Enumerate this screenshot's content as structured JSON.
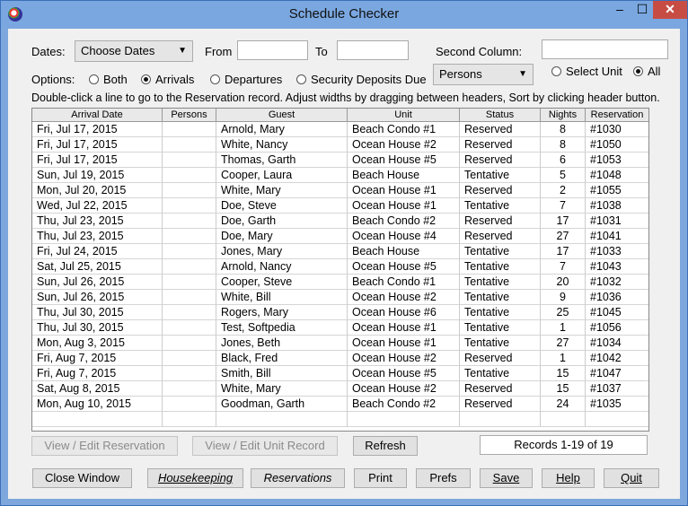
{
  "window": {
    "title": "Schedule Checker",
    "min_glyph": "–",
    "max_glyph": "☐",
    "close_glyph": "✕"
  },
  "filters": {
    "dates_label": "Dates:",
    "dates_value": "Choose Dates",
    "from_label": "From",
    "from_value": "",
    "to_label": "To",
    "to_value": "",
    "second_column_label": "Second Column:",
    "second_column_value": ""
  },
  "options": {
    "label": "Options:",
    "radios": [
      {
        "label": "Both",
        "selected": false
      },
      {
        "label": "Arrivals",
        "selected": true
      },
      {
        "label": "Departures",
        "selected": false
      },
      {
        "label": "Security Deposits Due",
        "selected": false
      }
    ],
    "column_select": "Persons",
    "unit_radios": [
      {
        "label": "Select Unit",
        "selected": false
      },
      {
        "label": "All",
        "selected": true
      }
    ]
  },
  "hint": "Double-click a line to go to the Reservation record. Adjust widths by dragging between headers, Sort by clicking header button.",
  "table": {
    "headers": [
      "Arrival Date",
      "Persons",
      "Guest",
      "Unit",
      "Status",
      "Nights",
      "Reservation"
    ],
    "rows": [
      [
        "Fri, Jul 17, 2015",
        "",
        "Arnold, Mary",
        "Beach Condo #1",
        "Reserved",
        "8",
        "#1030"
      ],
      [
        "Fri, Jul 17, 2015",
        "",
        "White, Nancy",
        "Ocean House #2",
        "Reserved",
        "8",
        "#1050"
      ],
      [
        "Fri, Jul 17, 2015",
        "",
        "Thomas, Garth",
        "Ocean House #5",
        "Reserved",
        "6",
        "#1053"
      ],
      [
        "Sun, Jul 19, 2015",
        "",
        "Cooper, Laura",
        "Beach House",
        "Tentative",
        "5",
        "#1048"
      ],
      [
        "Mon, Jul 20, 2015",
        "",
        "White, Mary",
        "Ocean House #1",
        "Reserved",
        "2",
        "#1055"
      ],
      [
        "Wed, Jul 22, 2015",
        "",
        "Doe, Steve",
        "Ocean House #1",
        "Tentative",
        "7",
        "#1038"
      ],
      [
        "Thu, Jul 23, 2015",
        "",
        "Doe, Garth",
        "Beach Condo #2",
        "Reserved",
        "17",
        "#1031"
      ],
      [
        "Thu, Jul 23, 2015",
        "",
        "Doe, Mary",
        "Ocean House #4",
        "Reserved",
        "27",
        "#1041"
      ],
      [
        "Fri, Jul 24, 2015",
        "",
        "Jones, Mary",
        "Beach House",
        "Tentative",
        "17",
        "#1033"
      ],
      [
        "Sat, Jul 25, 2015",
        "",
        "Arnold, Nancy",
        "Ocean House #5",
        "Tentative",
        "7",
        "#1043"
      ],
      [
        "Sun, Jul 26, 2015",
        "",
        "Cooper, Steve",
        "Beach Condo #1",
        "Tentative",
        "20",
        "#1032"
      ],
      [
        "Sun, Jul 26, 2015",
        "",
        "White, Bill",
        "Ocean House #2",
        "Tentative",
        "9",
        "#1036"
      ],
      [
        "Thu, Jul 30, 2015",
        "",
        "Rogers, Mary",
        "Ocean House #6",
        "Tentative",
        "25",
        "#1045"
      ],
      [
        "Thu, Jul 30, 2015",
        "",
        "Test, Softpedia",
        "Ocean House #1",
        "Tentative",
        "1",
        "#1056"
      ],
      [
        "Mon, Aug 3, 2015",
        "",
        "Jones, Beth",
        "Ocean House #1",
        "Tentative",
        "27",
        "#1034"
      ],
      [
        "Fri, Aug 7, 2015",
        "",
        "Black, Fred",
        "Ocean House #2",
        "Reserved",
        "1",
        "#1042"
      ],
      [
        "Fri, Aug 7, 2015",
        "",
        "Smith, Bill",
        "Ocean House #5",
        "Tentative",
        "15",
        "#1047"
      ],
      [
        "Sat, Aug 8, 2015",
        "",
        "White, Mary",
        "Ocean House #2",
        "Reserved",
        "15",
        "#1037"
      ],
      [
        "Mon, Aug 10, 2015",
        "",
        "Goodman, Garth",
        "Beach Condo #2",
        "Reserved",
        "24",
        "#1035"
      ],
      [
        "",
        "",
        "",
        "",
        "",
        "",
        ""
      ]
    ]
  },
  "actions": {
    "view_reservation": "View / Edit Reservation",
    "view_unit": "View / Edit Unit Record",
    "refresh": "Refresh",
    "records_status": "Records 1-19 of 19"
  },
  "bottom_buttons": {
    "close_window": "Close Window",
    "housekeeping": "Housekeeping",
    "reservations": "Reservations",
    "print": "Print",
    "prefs": "Prefs",
    "save": "Save",
    "help": "Help",
    "quit": "Quit"
  }
}
